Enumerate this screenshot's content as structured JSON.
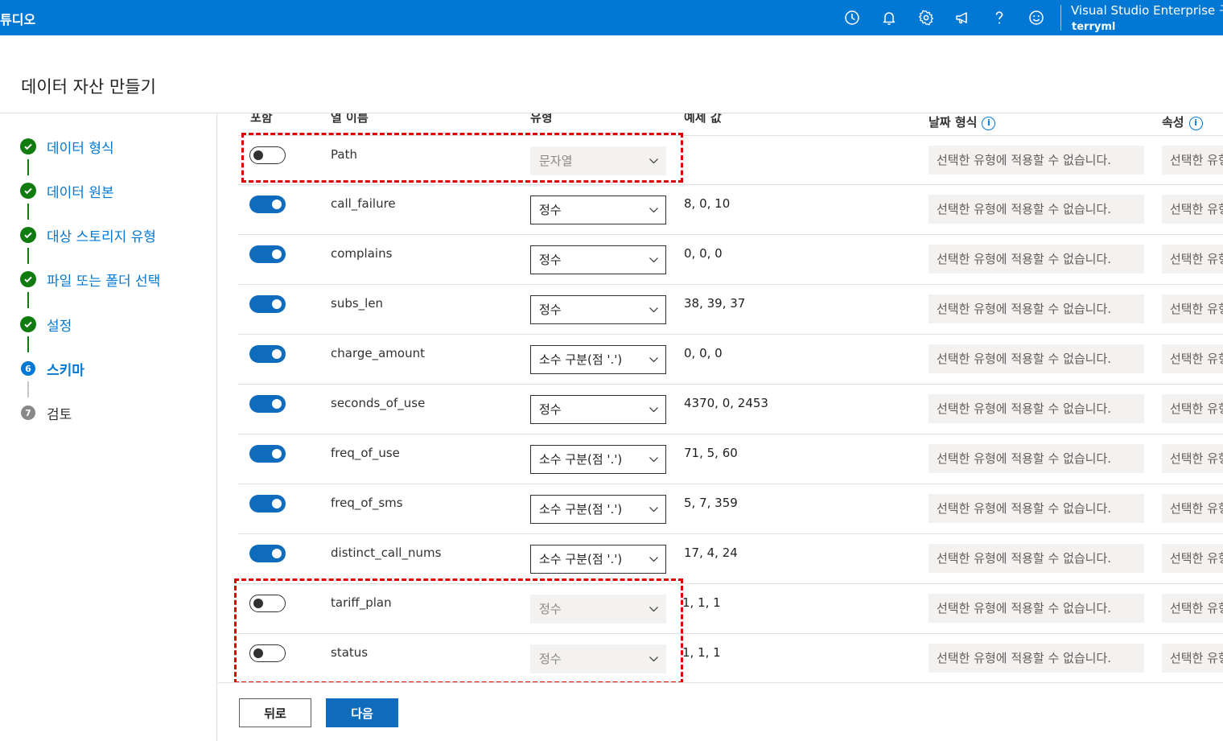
{
  "topbar": {
    "brand": "튜디오",
    "subscription": "Visual Studio Enterprise 구독",
    "user": "terryml",
    "icons": [
      "clock-icon",
      "bell-icon",
      "gear-icon",
      "megaphone-icon",
      "help-icon",
      "smiley-icon"
    ]
  },
  "page": {
    "title": "데이터 자산 만들기"
  },
  "stepper": {
    "steps": [
      {
        "label": "데이터 형식",
        "status": "done"
      },
      {
        "label": "데이터 원본",
        "status": "done"
      },
      {
        "label": "대상 스토리지 유형",
        "status": "done"
      },
      {
        "label": "파일 또는 폴더 선택",
        "status": "done"
      },
      {
        "label": "설정",
        "status": "done"
      },
      {
        "label": "스키마",
        "status": "current",
        "num": "6"
      },
      {
        "label": "검토",
        "status": "todo",
        "num": "7"
      }
    ]
  },
  "table": {
    "headers": {
      "include": "포함",
      "column_name": "열 이름",
      "type": "유형",
      "sample": "예제 값",
      "date_format": "날짜 형식",
      "properties": "속성"
    },
    "not_applicable": "선택한 유형에 적용할 수 없습니다.",
    "rows": [
      {
        "include": false,
        "name": "Path",
        "type": "문자열",
        "sample": ""
      },
      {
        "include": true,
        "name": "call_failure",
        "type": "정수",
        "sample": "8, 0, 10"
      },
      {
        "include": true,
        "name": "complains",
        "type": "정수",
        "sample": "0, 0, 0"
      },
      {
        "include": true,
        "name": "subs_len",
        "type": "정수",
        "sample": "38, 39, 37"
      },
      {
        "include": true,
        "name": "charge_amount",
        "type": "소수 구분(점 '.')",
        "sample": "0, 0, 0"
      },
      {
        "include": true,
        "name": "seconds_of_use",
        "type": "정수",
        "sample": "4370, 0, 2453"
      },
      {
        "include": true,
        "name": "freq_of_use",
        "type": "소수 구분(점 '.')",
        "sample": "71, 5, 60"
      },
      {
        "include": true,
        "name": "freq_of_sms",
        "type": "소수 구분(점 '.')",
        "sample": "5, 7, 359"
      },
      {
        "include": true,
        "name": "distinct_call_nums",
        "type": "소수 구분(점 '.')",
        "sample": "17, 4, 24"
      },
      {
        "include": false,
        "name": "tariff_plan",
        "type": "정수",
        "sample": "1, 1, 1"
      },
      {
        "include": false,
        "name": "status",
        "type": "정수",
        "sample": "1, 1, 1"
      }
    ]
  },
  "footer": {
    "back_label": "뒤로",
    "next_label": "다음"
  },
  "colors": {
    "accent": "#0078d4",
    "done": "#107c10",
    "highlight": "#e00000"
  }
}
